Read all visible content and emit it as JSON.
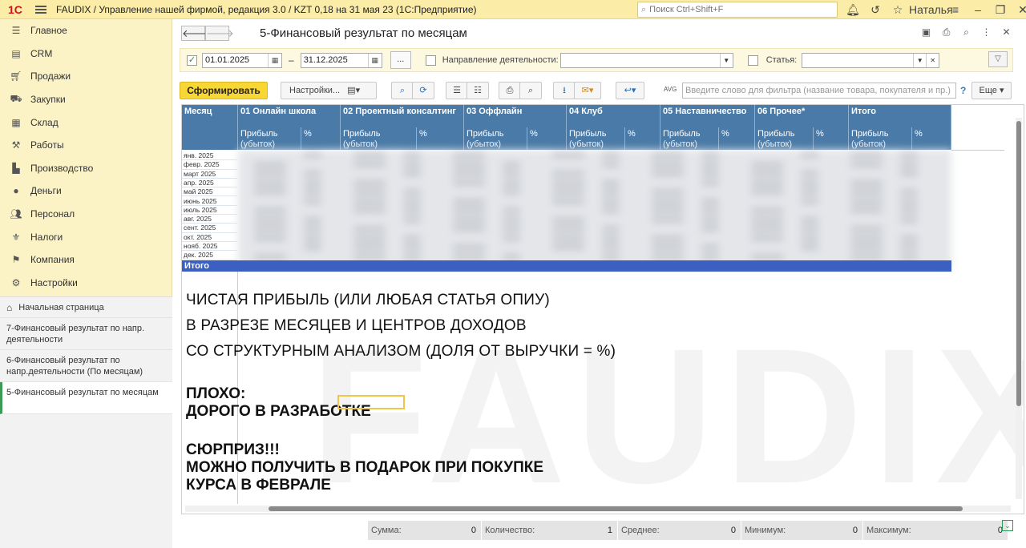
{
  "titlebar": {
    "logo": "1С",
    "title": "FAUDIX / Управление нашей фирмой, редакция 3.0 / KZT 0,18 на 31 мая 23  (1С:Предприятие)",
    "search_placeholder": "Поиск Ctrl+Shift+F",
    "user": "Наталья"
  },
  "sidebar": {
    "items": [
      {
        "label": "Главное",
        "icon": "menu-icon"
      },
      {
        "label": "CRM",
        "icon": "crm-icon"
      },
      {
        "label": "Продажи",
        "icon": "cart-icon"
      },
      {
        "label": "Закупки",
        "icon": "purchases-icon"
      },
      {
        "label": "Склад",
        "icon": "warehouse-icon"
      },
      {
        "label": "Работы",
        "icon": "tools-icon"
      },
      {
        "label": "Производство",
        "icon": "factory-icon"
      },
      {
        "label": "Деньги",
        "icon": "money-icon"
      },
      {
        "label": "Персонал",
        "icon": "people-icon"
      },
      {
        "label": "Налоги",
        "icon": "taxes-icon"
      },
      {
        "label": "Компания",
        "icon": "flag-icon"
      },
      {
        "label": "Настройки",
        "icon": "gear-icon"
      }
    ],
    "open_pages": [
      {
        "label": "Начальная страница"
      },
      {
        "label": "7-Финансовый результат по напр. деятельности"
      },
      {
        "label": "6-Финансовый результат по напр.деятельности (По месяцам)"
      },
      {
        "label": "5-Финансовый результат по месяцам"
      }
    ]
  },
  "form": {
    "title": "5-Финансовый результат по месяцам",
    "date_from": "01.01.2025",
    "date_sep": "–",
    "date_to": "31.12.2025",
    "dots": "...",
    "direction_label": "Направление деятельности:",
    "article_label": "Статья:",
    "generate_label": "Сформировать",
    "settings_label": "Настройки...",
    "avg_label": "AVG",
    "filter_placeholder": "Введите слово для фильтра (название товара, покупателя и пр.)",
    "help": "?",
    "more_label": "Еще"
  },
  "report": {
    "month_header": "Месяц",
    "columns": [
      {
        "name": "01 Онлайн школа"
      },
      {
        "name": "02 Проектный консалтинг"
      },
      {
        "name": "03 Оффлайн"
      },
      {
        "name": "04 Клуб"
      },
      {
        "name": "05 Наставничество"
      },
      {
        "name": "06 Прочее*"
      },
      {
        "name": "Итого"
      }
    ],
    "sub_profit": "Прибыль",
    "sub_profit2": "(убыток)",
    "sub_pct": "%",
    "months": [
      "янв. 2025",
      "февр. 2025",
      "март 2025",
      "апр. 2025",
      "май 2025",
      "июнь 2025",
      "июль 2025",
      "авг. 2025",
      "сент. 2025",
      "окт. 2025",
      "нояб. 2025",
      "дек. 2025"
    ],
    "total_label": "Итого"
  },
  "overlay": {
    "lines": [
      "ЧИСТАЯ ПРИБЫЛЬ (ИЛИ ЛЮБАЯ СТАТЬЯ ОПИУ)",
      "В РАЗРЕЗЕ МЕСЯЦЕВ И ЦЕНТРОВ ДОХОДОВ",
      "СО СТРУКТУРНЫМ АНАЛИЗОМ (ДОЛЯ ОТ ВЫРУЧКИ = %)"
    ],
    "bad_title": "ПЛОХО:",
    "bad_text": "ДОРОГО В РАЗРАБОТКЕ",
    "surprise_title": "СЮРПРИЗ!!!",
    "surprise_line1": "МОЖНО ПОЛУЧИТЬ В ПОДАРОК ПРИ ПОКУПКЕ",
    "surprise_line2": "КУРСА В ФЕВРАЛЕ",
    "watermark": "FAUDIX"
  },
  "totals": {
    "sum_label": "Сумма:",
    "sum_value": "0",
    "count_label": "Количество:",
    "count_value": "1",
    "avg_label": "Среднее:",
    "avg_value": "0",
    "min_label": "Минимум:",
    "min_value": "0",
    "max_label": "Максимум:",
    "max_value": "0"
  },
  "colors": {
    "header_bg": "#4a7aa7",
    "total_row": "#3c60c2",
    "accent_button": "#f8d634",
    "titlebar": "#fbeda7",
    "sidebar": "#fbf2c6"
  }
}
